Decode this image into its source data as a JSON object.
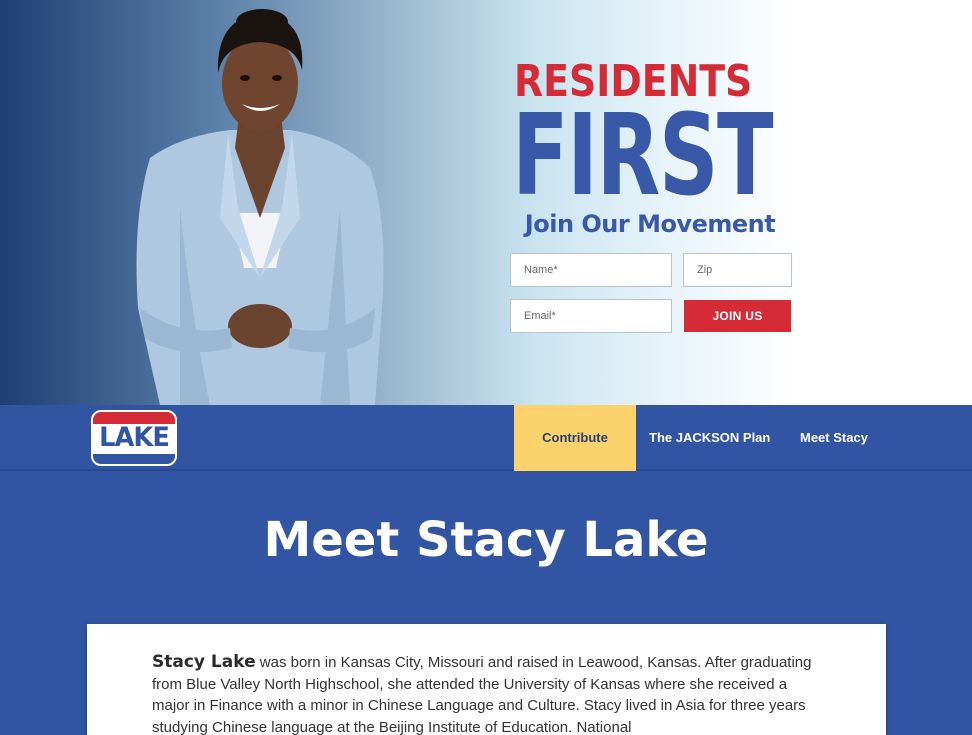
{
  "hero": {
    "headline_top": "RESIDENTS",
    "headline_main": "FIRST",
    "tagline": "Join Our Movement",
    "form": {
      "name_placeholder": "Name*",
      "zip_placeholder": "Zip",
      "email_placeholder": "Email*",
      "submit_label": "JOIN US"
    }
  },
  "nav": {
    "logo_text": "LAKE",
    "items": [
      {
        "label": "Contribute"
      },
      {
        "label": "The JACKSON Plan"
      },
      {
        "label": "Meet Stacy"
      }
    ]
  },
  "main": {
    "title": "Meet Stacy Lake",
    "bio_name": "Stacy Lake",
    "bio_text": " was born in Kansas City, Missouri and raised in Leawood, Kansas. After graduating from Blue Valley North Highschool, she attended the University of Kansas where she received a major in Finance with a minor in Chinese Language and Culture. Stacy lived in Asia for three years studying Chinese language at the Beijing Institute of Education. National"
  },
  "colors": {
    "brand_blue": "#3155a3",
    "brand_red": "#d42b36",
    "accent_yellow": "#fbd26b"
  }
}
